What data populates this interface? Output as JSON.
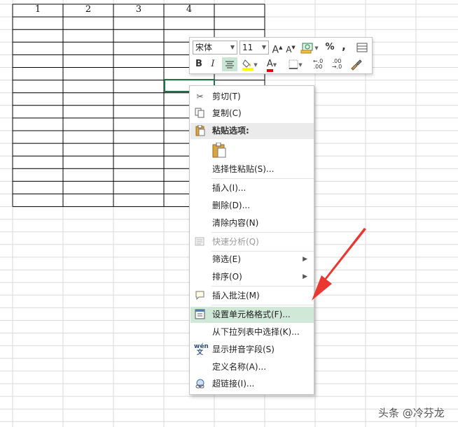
{
  "spreadsheet": {
    "column_headers": [
      "1",
      "2",
      "3",
      "4",
      ""
    ]
  },
  "mini_toolbar": {
    "font_name": "宋体",
    "font_size": "11",
    "bold_label": "B",
    "italic_label": "I",
    "percent_label": "%",
    "comma_label": ",",
    "font_color_label": "A",
    "grow_font_label": "A",
    "shrink_font_label": "A",
    "increase_decimal_label": "←.0 .00",
    "decrease_decimal_label": ".00 →.0"
  },
  "context_menu": {
    "items": [
      {
        "label": "剪切(T)",
        "icon": "scissors-icon",
        "enabled": true
      },
      {
        "label": "复制(C)",
        "icon": "copy-icon",
        "enabled": true
      },
      {
        "label": "粘贴选项:",
        "icon": "clipboard-icon",
        "enabled": true,
        "section": true
      },
      {
        "label": "选择性粘贴(S)...",
        "icon": "",
        "enabled": true
      },
      {
        "label": "插入(I)...",
        "icon": "",
        "enabled": true
      },
      {
        "label": "删除(D)...",
        "icon": "",
        "enabled": true
      },
      {
        "label": "清除内容(N)",
        "icon": "",
        "enabled": true
      },
      {
        "label": "快速分析(Q)",
        "icon": "quick-analysis-icon",
        "enabled": false
      },
      {
        "label": "筛选(E)",
        "icon": "",
        "enabled": true,
        "submenu": true
      },
      {
        "label": "排序(O)",
        "icon": "",
        "enabled": true,
        "submenu": true
      },
      {
        "label": "插入批注(M)",
        "icon": "comment-icon",
        "enabled": true
      },
      {
        "label": "设置单元格格式(F)...",
        "icon": "format-cells-icon",
        "enabled": true,
        "highlighted": true
      },
      {
        "label": "从下拉列表中选择(K)...",
        "icon": "",
        "enabled": true
      },
      {
        "label": "显示拼音字段(S)",
        "icon": "phonetic-icon",
        "enabled": true
      },
      {
        "label": "定义名称(A)...",
        "icon": "",
        "enabled": true
      },
      {
        "label": "超链接(I)...",
        "icon": "hyperlink-icon",
        "enabled": true
      }
    ]
  },
  "watermark": "头条 @冷芬龙",
  "colors": {
    "highlight": "#cfe8d7",
    "selection_border": "#217346",
    "arrow": "#e8382f",
    "font_color_bar": "#e00000",
    "fill_color_bar": "#ffff00"
  }
}
